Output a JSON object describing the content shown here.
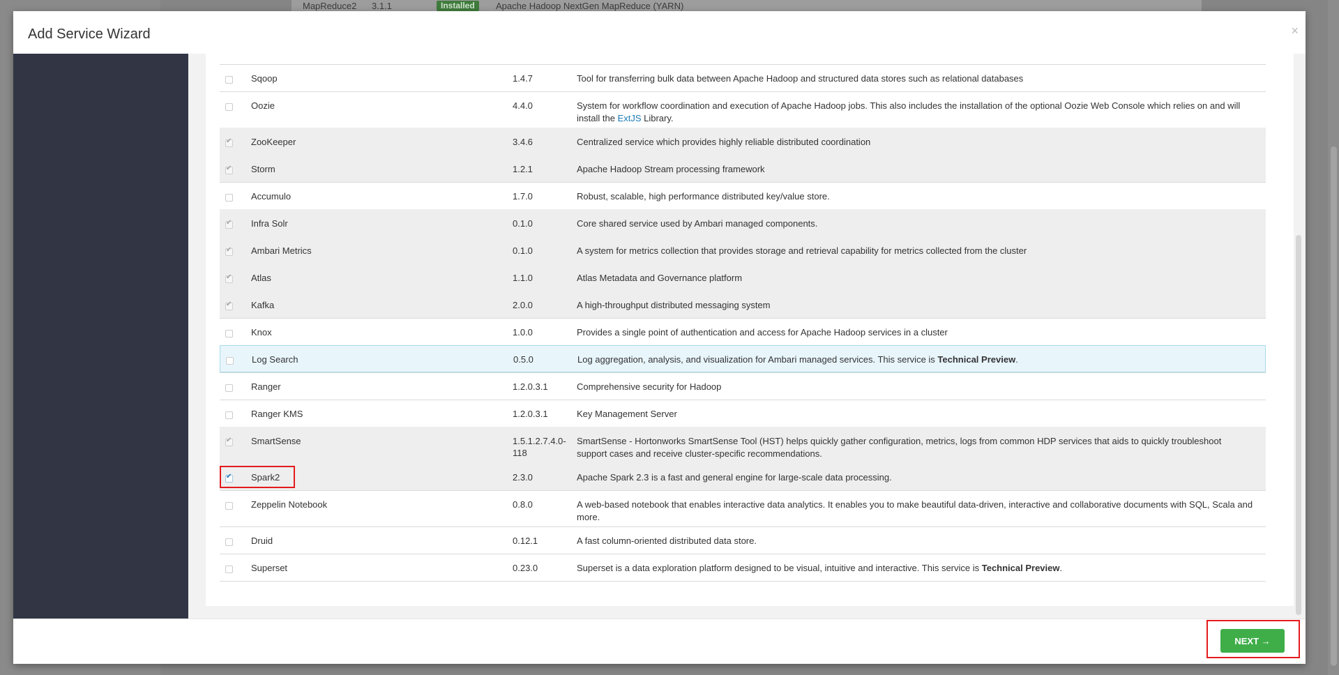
{
  "background": {
    "row": {
      "name": "MapReduce2",
      "version": "3.1.1",
      "status": "Installed",
      "description": "Apache Hadoop NextGen MapReduce (YARN)"
    }
  },
  "modal": {
    "title": "Add Service Wizard",
    "close_label": "×",
    "next_label": "NEXT →"
  },
  "services": [
    {
      "name": "Sqoop",
      "version": "1.4.7",
      "description": "Tool for transferring bulk data between Apache Hadoop and structured data stores such as relational databases",
      "checked": false
    },
    {
      "name": "Oozie",
      "version": "4.4.0",
      "description_before": "System for workflow coordination and execution of Apache Hadoop jobs. This also includes the installation of the optional Oozie Web Console which relies on and will install the ",
      "description_link": "ExtJS",
      "description_after": " Library.",
      "checked": false
    },
    {
      "name": "ZooKeeper",
      "version": "3.4.6",
      "description": "Centralized service which provides highly reliable distributed coordination",
      "checked": true
    },
    {
      "name": "Storm",
      "version": "1.2.1",
      "description": "Apache Hadoop Stream processing framework",
      "checked": true
    },
    {
      "name": "Accumulo",
      "version": "1.7.0",
      "description": "Robust, scalable, high performance distributed key/value store.",
      "checked": false
    },
    {
      "name": "Infra Solr",
      "version": "0.1.0",
      "description": "Core shared service used by Ambari managed components.",
      "checked": true
    },
    {
      "name": "Ambari Metrics",
      "version": "0.1.0",
      "description": "A system for metrics collection that provides storage and retrieval capability for metrics collected from the cluster",
      "checked": true
    },
    {
      "name": "Atlas",
      "version": "1.1.0",
      "description": "Atlas Metadata and Governance platform",
      "checked": true
    },
    {
      "name": "Kafka",
      "version": "2.0.0",
      "description": "A high-throughput distributed messaging system",
      "checked": true
    },
    {
      "name": "Knox",
      "version": "1.0.0",
      "description": "Provides a single point of authentication and access for Apache Hadoop services in a cluster",
      "checked": false
    },
    {
      "name": "Log Search",
      "version": "0.5.0",
      "description_before": "Log aggregation, analysis, and visualization for Ambari managed services. This service is ",
      "description_bold": "Technical Preview",
      "description_after": ".",
      "checked": false
    },
    {
      "name": "Ranger",
      "version": "1.2.0.3.1",
      "description": "Comprehensive security for Hadoop",
      "checked": false
    },
    {
      "name": "Ranger KMS",
      "version": "1.2.0.3.1",
      "description": "Key Management Server",
      "checked": false
    },
    {
      "name": "SmartSense",
      "version": "1.5.1.2.7.4.0-118",
      "description": "SmartSense - Hortonworks SmartSense Tool (HST) helps quickly gather configuration, metrics, logs from common HDP services that aids to quickly troubleshoot support cases and receive cluster-specific recommendations.",
      "checked": true
    },
    {
      "name": "Spark2",
      "version": "2.3.0",
      "description": "Apache Spark 2.3 is a fast and general engine for large-scale data processing.",
      "checked": true
    },
    {
      "name": "Zeppelin Notebook",
      "version": "0.8.0",
      "description": "A web-based notebook that enables interactive data analytics. It enables you to make beautiful data-driven, interactive and collaborative documents with SQL, Scala and more.",
      "checked": false
    },
    {
      "name": "Druid",
      "version": "0.12.1",
      "description": "A fast column-oriented distributed data store.",
      "checked": false
    },
    {
      "name": "Superset",
      "version": "0.23.0",
      "description_before": "Superset is a data exploration platform designed to be visual, intuitive and interactive. This service is ",
      "description_bold": "Technical Preview",
      "description_after": ".",
      "checked": false
    }
  ]
}
